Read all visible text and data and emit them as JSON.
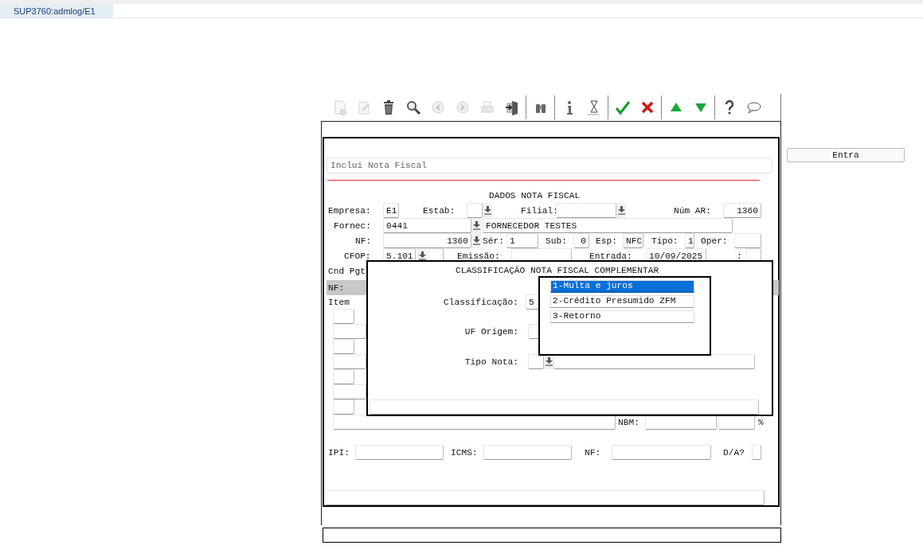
{
  "tab": {
    "title": "SUP3760:admlog/E1",
    "selected": true
  },
  "toolbar": [
    {
      "kind": "new",
      "disabled": true
    },
    {
      "kind": "edit",
      "disabled": true
    },
    {
      "kind": "trash",
      "disabled": false
    },
    {
      "kind": "search",
      "disabled": false
    },
    {
      "kind": "back",
      "disabled": true
    },
    {
      "kind": "forward",
      "disabled": true
    },
    {
      "kind": "print",
      "disabled": true
    },
    {
      "kind": "exit",
      "disabled": false
    },
    {
      "kind": "separator"
    },
    {
      "kind": "binoculars",
      "disabled": false
    },
    {
      "kind": "separator"
    },
    {
      "kind": "info",
      "disabled": false
    },
    {
      "kind": "hourglass",
      "disabled": false
    },
    {
      "kind": "separator"
    },
    {
      "kind": "confirm",
      "disabled": false
    },
    {
      "kind": "cancel",
      "disabled": false
    },
    {
      "kind": "separator"
    },
    {
      "kind": "up",
      "disabled": false
    },
    {
      "kind": "down",
      "disabled": false
    },
    {
      "kind": "separator"
    },
    {
      "kind": "help",
      "disabled": false
    },
    {
      "kind": "comment",
      "disabled": false
    }
  ],
  "entra_button": "Entra",
  "header": "Inclui Nota Fiscal",
  "section_title": "DADOS NOTA FISCAL",
  "labels": [
    {
      "text": "Empresa:"
    },
    {
      "text": "Estab:"
    },
    {
      "text": "Filial:"
    },
    {
      "text": "Núm AR:"
    },
    {
      "text": "Fornec:"
    },
    {
      "text": "NF:"
    },
    {
      "text": "Sér:"
    },
    {
      "text": "Sub:"
    },
    {
      "text": "Esp:"
    },
    {
      "text": "Tipo:"
    },
    {
      "text": "Oper:"
    },
    {
      "text": "CFOP:"
    },
    {
      "text": "Emissão:"
    },
    {
      "text": "Entrada:"
    },
    {
      "text": ":"
    },
    {
      "text": "Cnd Pgt"
    },
    {
      "text": "NF:"
    },
    {
      "text": "Item"
    },
    {
      "text": "NBM:"
    },
    {
      "text": "%"
    },
    {
      "text": "IPI:"
    },
    {
      "text": "ICMS:"
    },
    {
      "text": "NF:"
    },
    {
      "text": "D/A?"
    }
  ],
  "inputs": [
    {
      "kind": "field",
      "value": "E1"
    },
    {
      "kind": "field"
    },
    {
      "kind": "lookup"
    },
    {
      "kind": "field"
    },
    {
      "kind": "lookup"
    },
    {
      "kind": "field",
      "value": "1360"
    },
    {
      "kind": "field",
      "value": "0441"
    },
    {
      "kind": "lookup"
    },
    {
      "kind": "field",
      "value": "FORNECEDOR TESTES"
    },
    {
      "kind": "field",
      "value": "1360"
    },
    {
      "kind": "lookup"
    },
    {
      "kind": "field",
      "value": "1"
    },
    {
      "kind": "field",
      "value": "0"
    },
    {
      "kind": "field",
      "value": "NFC"
    },
    {
      "kind": "field",
      "value": "1"
    },
    {
      "kind": "field"
    },
    {
      "kind": "field",
      "value": "5.101"
    },
    {
      "kind": "lookup"
    },
    {
      "kind": "field"
    },
    {
      "kind": "field"
    },
    {
      "kind": "field",
      "value": "10/09/2025"
    },
    {
      "kind": "field"
    },
    {
      "kind": "field"
    },
    {
      "kind": "field"
    },
    {
      "kind": "field"
    },
    {
      "kind": "field"
    },
    {
      "kind": "field"
    },
    {
      "kind": "field"
    },
    {
      "kind": "field"
    },
    {
      "kind": "field"
    },
    {
      "kind": "field"
    },
    {
      "kind": "field"
    },
    {
      "kind": "field"
    },
    {
      "kind": "field"
    },
    {
      "kind": "field"
    },
    {
      "kind": "field"
    },
    {
      "kind": "field"
    }
  ],
  "dialog": {
    "title": "CLASSIFICAÇÃO NOTA FISCAL COMPLEMENTAR",
    "labels": [
      {
        "text": "Classificação:"
      },
      {
        "text": "UF Origem:"
      },
      {
        "text": "Tipo Nota:"
      }
    ],
    "inputs": [
      {
        "kind": "field",
        "value": "5"
      },
      {
        "kind": "field"
      },
      {
        "kind": "field"
      },
      {
        "kind": "lookup"
      },
      {
        "kind": "field"
      },
      {
        "kind": "field"
      }
    ]
  },
  "dropdown": {
    "items": [
      {
        "label": "1-Multa e juros",
        "selected": true
      },
      {
        "label": "2-Crédito Presumido ZFM",
        "selected": false
      },
      {
        "label": "3-Retorno",
        "selected": false
      }
    ]
  }
}
